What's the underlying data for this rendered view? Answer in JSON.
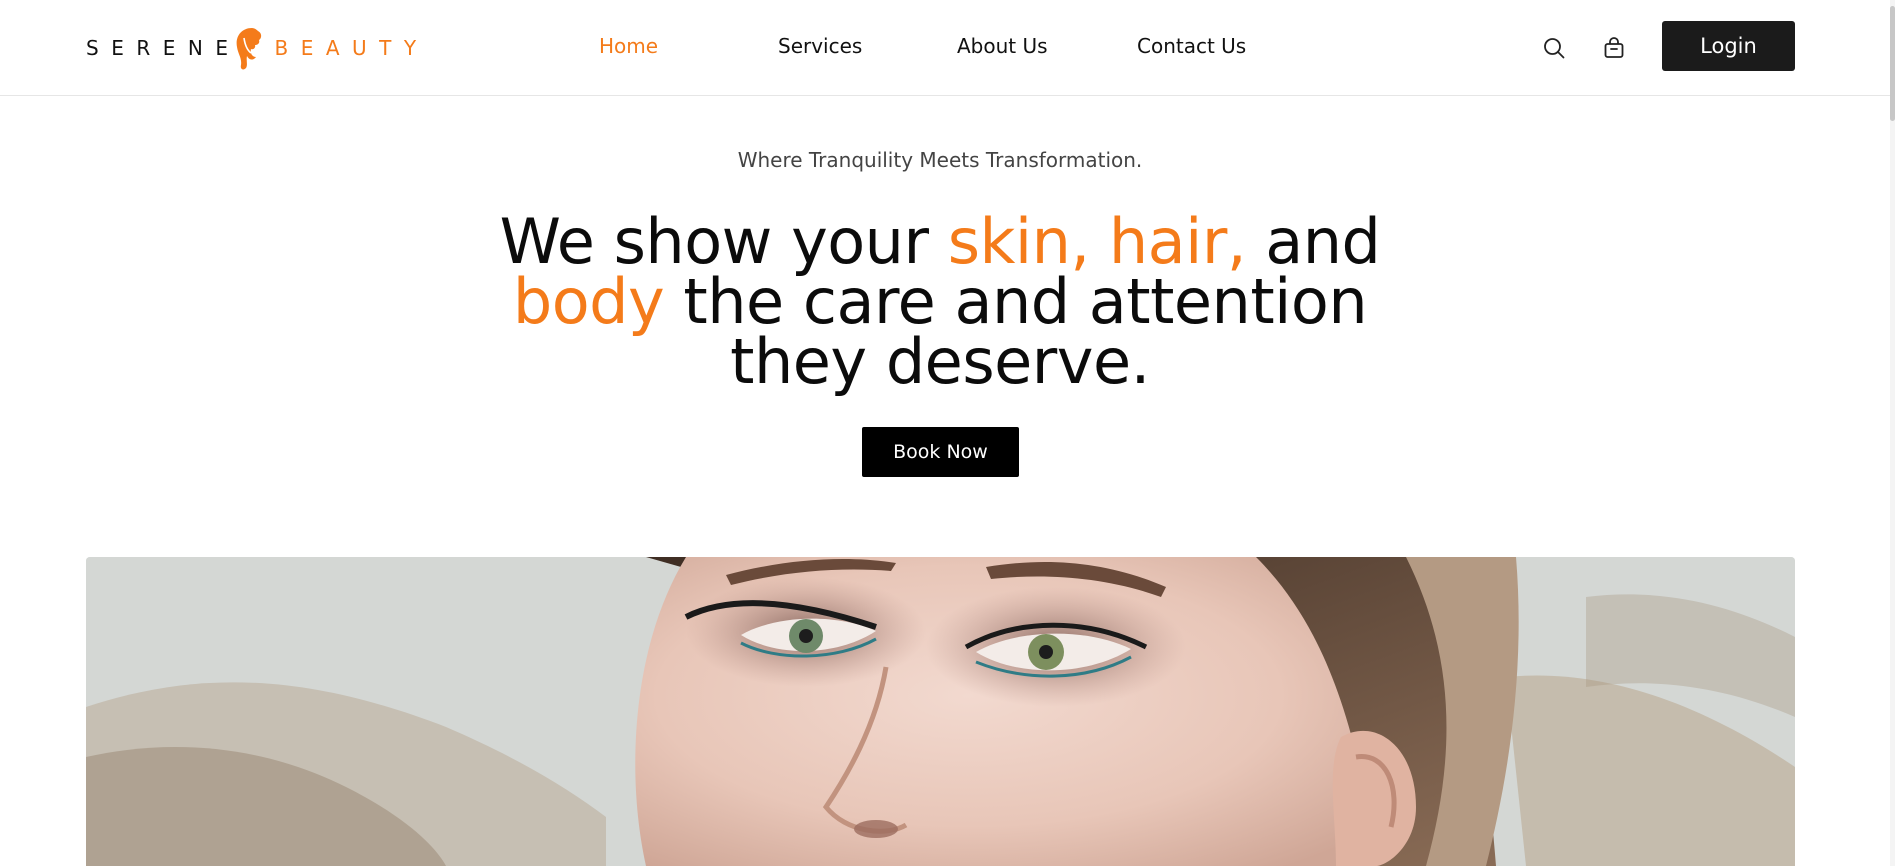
{
  "brand": {
    "name_left": "SERENE",
    "name_right": "BEAUTY",
    "logo_icon": "woman-hair-silhouette-icon",
    "accent_color": "#f47b1a"
  },
  "nav": {
    "items": [
      {
        "label": "Home",
        "active": true
      },
      {
        "label": "Services",
        "active": false
      },
      {
        "label": "About Us",
        "active": false
      },
      {
        "label": "Contact Us",
        "active": false
      }
    ]
  },
  "header_actions": {
    "search_icon": "search-icon",
    "cart_icon": "shopping-bag-icon",
    "login_label": "Login"
  },
  "hero": {
    "tagline": "Where Tranquility Meets Transformation.",
    "headline": {
      "part1": "We show your ",
      "accent1": "skin, hair,",
      "part2": " and",
      "accent2": "body",
      "part3": " the care and attention",
      "part4": "they deserve."
    },
    "cta_label": "Book Now"
  }
}
